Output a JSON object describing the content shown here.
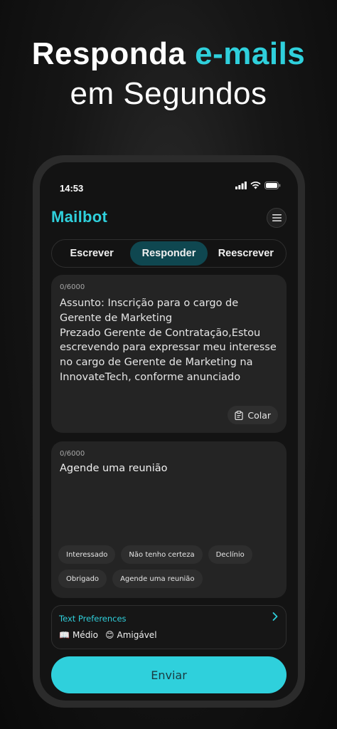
{
  "headline": {
    "line1_part1": "Responda ",
    "line1_accent": "e-mails",
    "line2": "em Segundos"
  },
  "status_bar": {
    "time": "14:53"
  },
  "app": {
    "logo": "Mailbot"
  },
  "tabs": [
    {
      "label": "Escrever",
      "active": false
    },
    {
      "label": "Responder",
      "active": true
    },
    {
      "label": "Reescrever",
      "active": false
    }
  ],
  "input_card": {
    "counter": "0/6000",
    "text": "Assunto: Inscrição para o cargo de Gerente de Marketing\nPrezado Gerente de Contratação,Estou escrevendo para expressar meu interesse no cargo de Gerente de Marketing na InnovateTech, conforme anunciado",
    "paste_label": "Colar"
  },
  "prompt_card": {
    "counter": "0/6000",
    "text": "Agende uma reunião",
    "chips": [
      "Interessado",
      "Não tenho certeza",
      "Declínio",
      "Obrigado",
      "Agende uma reunião"
    ]
  },
  "preferences": {
    "title": "Text Preferences",
    "length_emoji": "📖",
    "length": "Médio",
    "tone_emoji": "😊",
    "tone": "Amigável"
  },
  "send_label": "Enviar",
  "colors": {
    "accent": "#2fd0dc",
    "active_tab": "#0f4750",
    "card": "#242424"
  }
}
